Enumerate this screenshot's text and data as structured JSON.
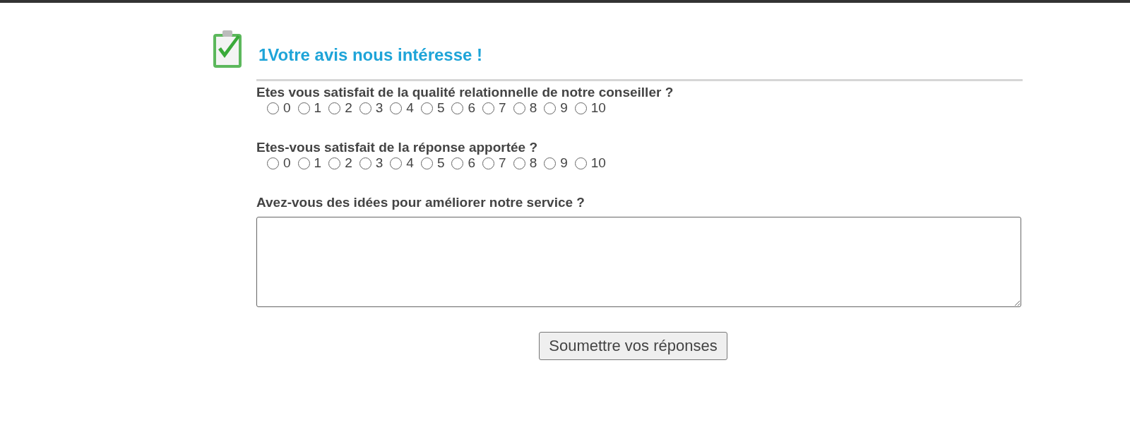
{
  "title": "1Votre avis nous intéresse !",
  "questions": [
    {
      "kind": "scale",
      "label": "Etes vous satisfait de la qualité relationnelle de notre conseiller ?",
      "options": [
        {
          "label": "0",
          "selected": false
        },
        {
          "label": "1",
          "selected": false
        },
        {
          "label": "2",
          "selected": false
        },
        {
          "label": "3",
          "selected": false
        },
        {
          "label": "4",
          "selected": false
        },
        {
          "label": "5",
          "selected": false
        },
        {
          "label": "6",
          "selected": false
        },
        {
          "label": "7",
          "selected": false
        },
        {
          "label": "8",
          "selected": false
        },
        {
          "label": "9",
          "selected": false
        },
        {
          "label": "10",
          "selected": false
        }
      ]
    },
    {
      "kind": "scale",
      "label": "Etes-vous satisfait de la réponse apportée ?",
      "options": [
        {
          "label": "0",
          "selected": false
        },
        {
          "label": "1",
          "selected": false
        },
        {
          "label": "2",
          "selected": false
        },
        {
          "label": "3",
          "selected": false
        },
        {
          "label": "4",
          "selected": false
        },
        {
          "label": "5",
          "selected": false
        },
        {
          "label": "6",
          "selected": false
        },
        {
          "label": "7",
          "selected": false
        },
        {
          "label": "8",
          "selected": false
        },
        {
          "label": "9",
          "selected": false
        },
        {
          "label": "10",
          "selected": false
        }
      ]
    },
    {
      "kind": "text",
      "label": "Avez-vous des idées pour améliorer notre service ?"
    }
  ],
  "submit": "Soumettre vos réponses"
}
